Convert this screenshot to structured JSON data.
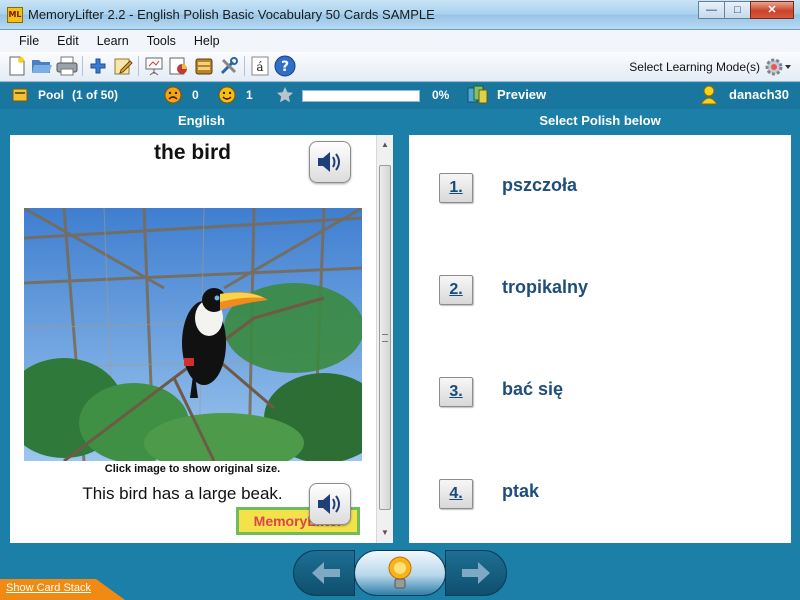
{
  "window": {
    "title": "MemoryLifter 2.2 - English Polish Basic Vocabulary 50 Cards SAMPLE",
    "app_icon_text": "ML",
    "min": "—",
    "max": "□",
    "close": "✕"
  },
  "menu": [
    "File",
    "Edit",
    "Learn",
    "Tools",
    "Help"
  ],
  "toolbar": {
    "mode_label": "Select Learning Mode(s)",
    "icons": [
      "new-file-icon",
      "open-folder-icon",
      "print-icon",
      "add-icon",
      "edit-icon",
      "slideshow-icon",
      "statistics-icon",
      "card-box-icon",
      "tools-icon",
      "font-icon",
      "help-icon",
      "gear-icon"
    ]
  },
  "status": {
    "pool_label": "Pool",
    "pool_count": "(1 of 50)",
    "wrong_count": "0",
    "right_count": "1",
    "progress_pct": "0%",
    "progress_fraction": 0,
    "preview": "Preview",
    "user": "danach30"
  },
  "columns": {
    "left_header": "English",
    "right_header": "Select Polish below"
  },
  "card": {
    "word": "the bird",
    "image_caption": "Click image to show original size.",
    "example_sentence": "This bird has a large beak.",
    "logo_text": "MemoryLifter"
  },
  "answers": [
    {
      "number": "1.",
      "text": "pszczoła"
    },
    {
      "number": "2.",
      "text": "tropikalny"
    },
    {
      "number": "3.",
      "text": "bać się"
    },
    {
      "number": "4.",
      "text": "ptak"
    }
  ],
  "bottom": {
    "show_stack": "Show Card Stack"
  },
  "colors": {
    "panel": "#1c7fa8",
    "answer_text": "#1f4d7c",
    "accent_orange": "#f08a12"
  }
}
